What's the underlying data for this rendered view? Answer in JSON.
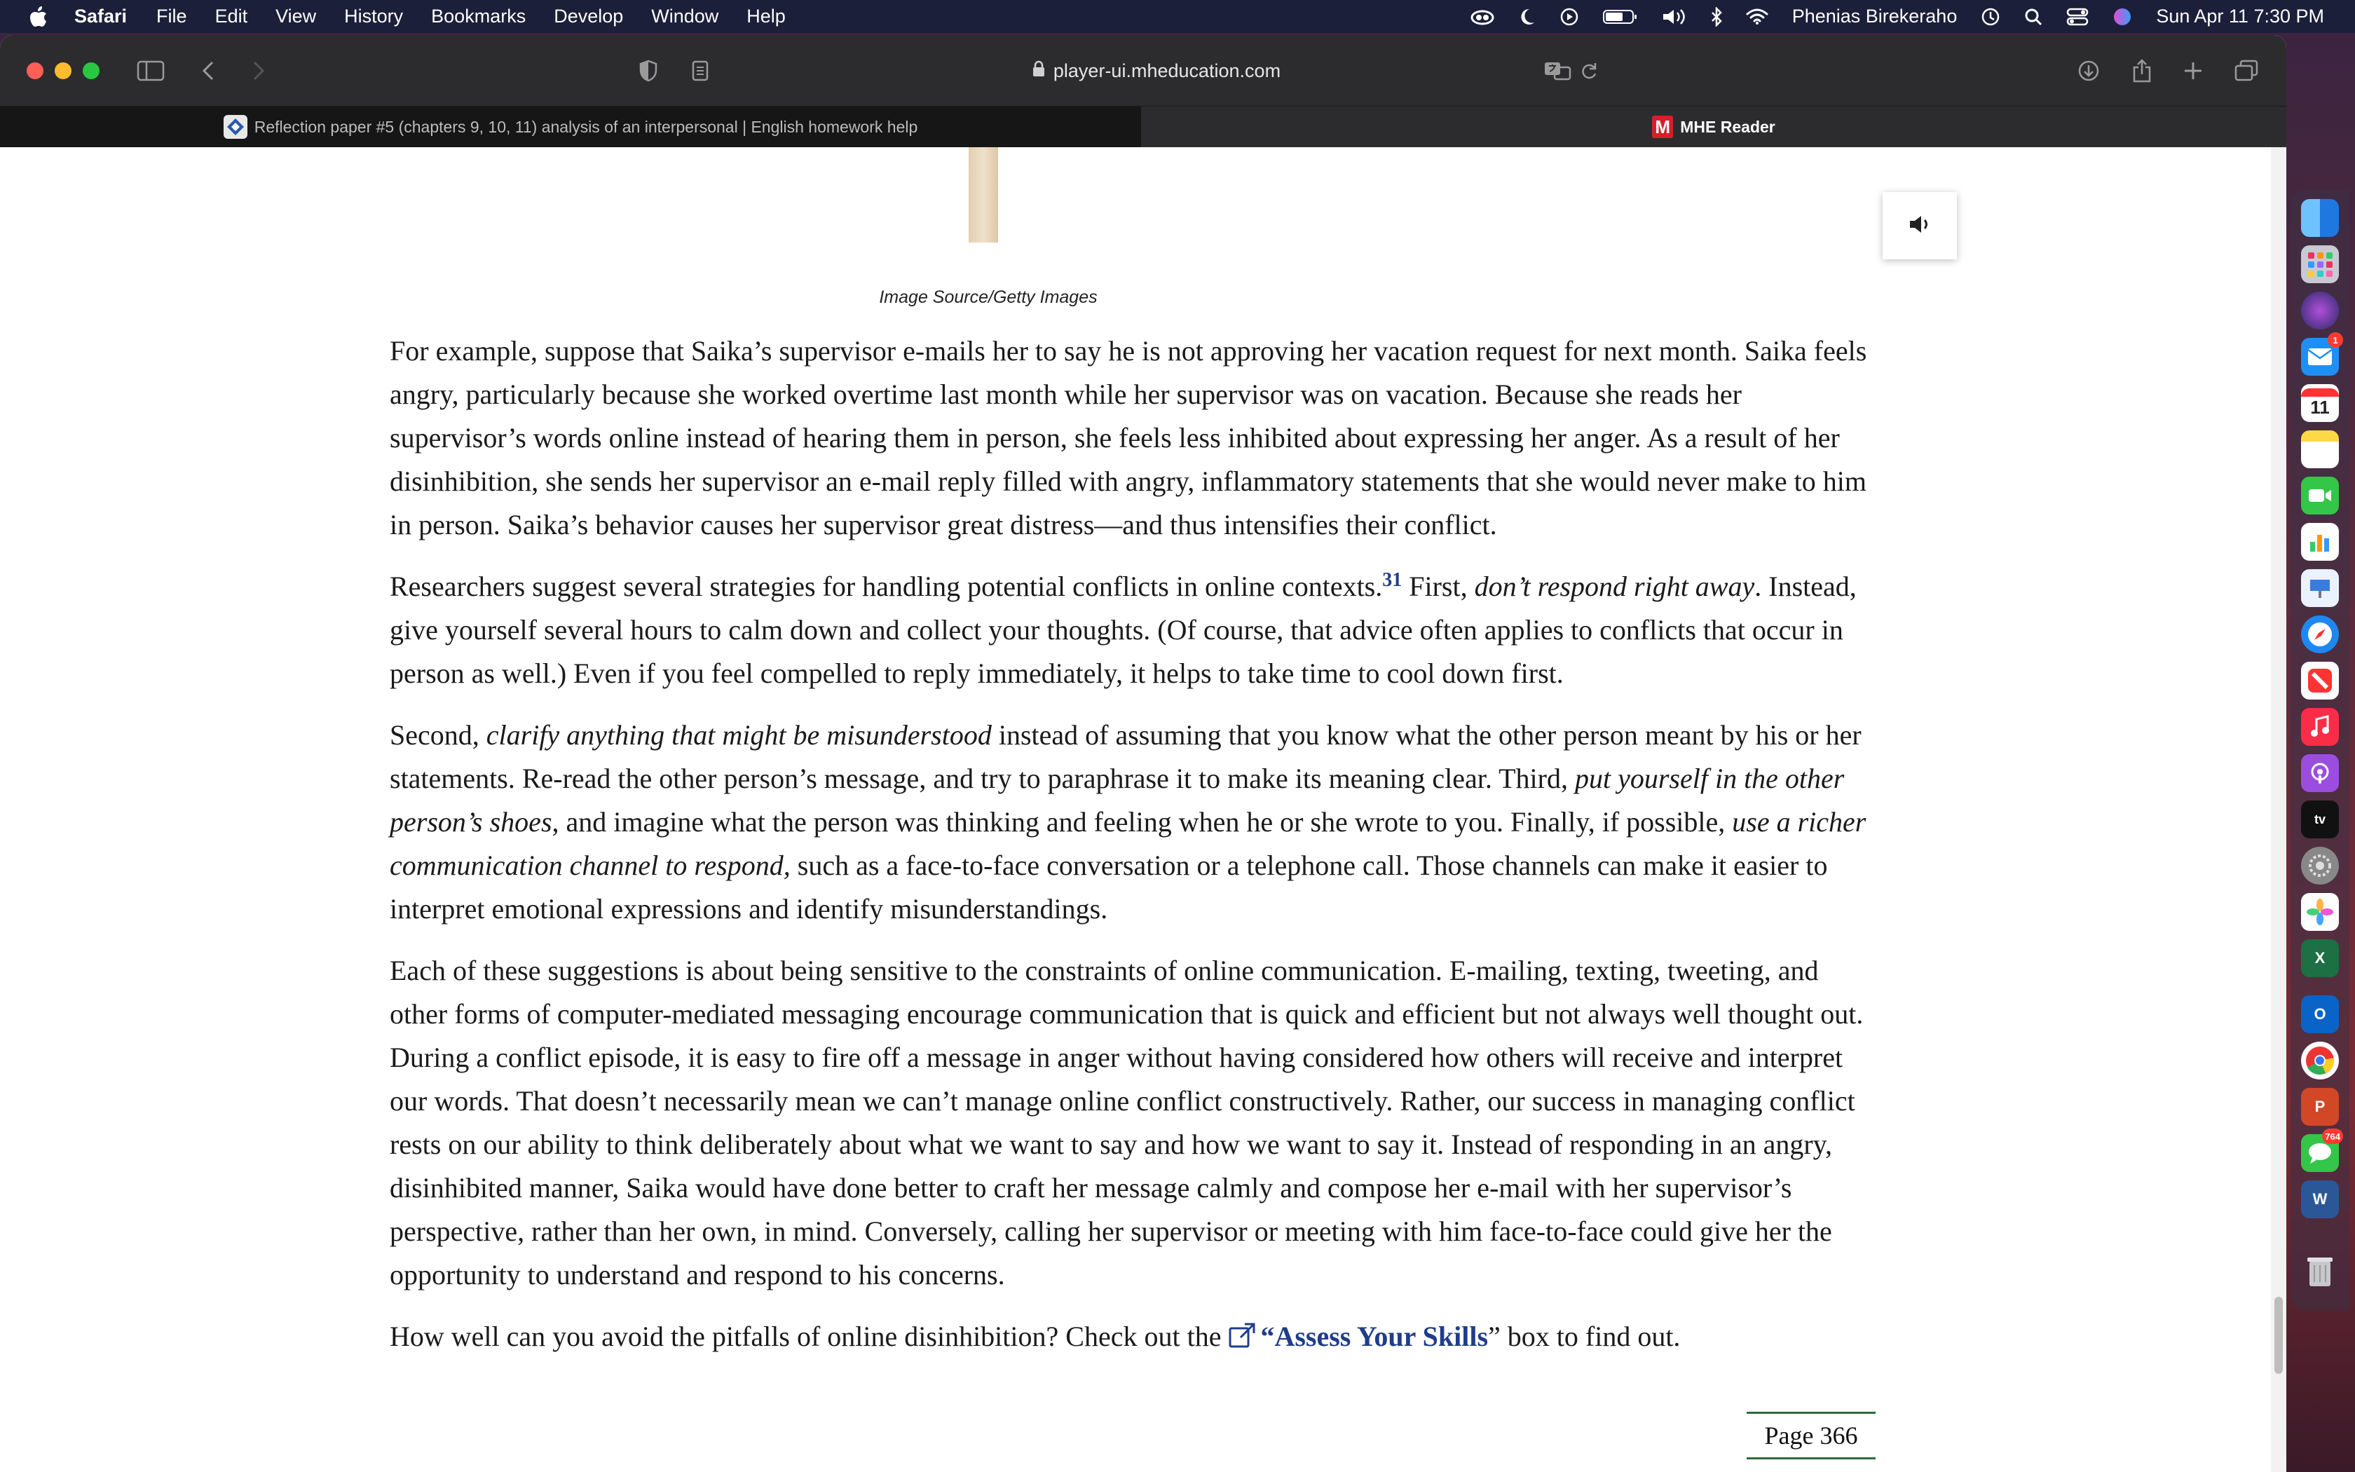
{
  "menubar": {
    "app_name": "Safari",
    "menus": [
      "File",
      "Edit",
      "View",
      "History",
      "Bookmarks",
      "Develop",
      "Window",
      "Help"
    ],
    "user_name": "Phenias Birekeraho",
    "datetime": "Sun Apr 11  7:30 PM"
  },
  "browser": {
    "url": "player-ui.mheducation.com",
    "tabs": [
      {
        "title": "Reflection paper #5 (chapters 9, 10, 11) analysis of an interpersonal | English homework help",
        "active": false
      },
      {
        "title": "MHE Reader",
        "active": true
      }
    ]
  },
  "content": {
    "image_caption": "Image Source/Getty Images",
    "paragraphs": {
      "p1": "For example, suppose that Saika’s supervisor e-mails her to say he is not approving her vacation request for next month. Saika feels angry, particularly because she worked overtime last month while her supervisor was on vacation. Because she reads her supervisor’s words online instead of hearing them in person, she feels less inhibited about expressing her anger. As a result of her disinhibition, she sends her supervisor an e-mail reply filled with angry, inflammatory statements that she would never make to him in person. Saika’s behavior causes her supervisor great distress—and thus intensifies their conflict.",
      "p2_a": "Researchers suggest several strategies for handling potential conflicts in online contexts.",
      "p2_sup": "31",
      "p2_b": " First, ",
      "p2_i1": "don’t respond right away",
      "p2_c": ". Instead, give yourself several hours to calm down and collect your thoughts. (Of course, that advice often applies to conflicts that occur in person as well.) Even if you feel compelled to reply immediately, it helps to take time to cool down first.",
      "p3_a": "Second, ",
      "p3_i1": "clarify anything that might be misunderstood",
      "p3_b": " instead of assuming that you know what the other person meant by his or her statements. Re-read the other person’s message, and try to paraphrase it to make its meaning clear. Third, ",
      "p3_i2": "put yourself in the other person’s shoes",
      "p3_c": ", and imagine what the person was thinking and feeling when he or she wrote to you. Finally, if possible, ",
      "p3_i3": "use a richer communication channel to respond,",
      "p3_d": " such as a face-to-face conversation or a telephone call. Those channels can make it easier to interpret emotional expressions and identify misunderstandings.",
      "p4": "Each of these suggestions is about being sensitive to the constraints of online communication. E-mailing, texting, tweeting, and other forms of computer-mediated messaging encourage communication that is quick and efficient but not always well thought out. During a conflict episode, it is easy to fire off a message in anger without having considered how others will receive and interpret our words. That doesn’t necessarily mean we can’t manage online conflict constructively. Rather, our success in managing conflict rests on our ability to think deliberately about what we want to say and how we want to say it. Instead of responding in an angry, disinhibited manner, Saika would have done better to craft her message calmly and compose her e-mail with her supervisor’s perspective, rather than her own, in mind. Conversely, calling her supervisor or meeting with him face-to-face could give her the opportunity to understand and respond to his concerns.",
      "p5_a": "How well can you avoid the pitfalls of online disinhibition? Check out the ",
      "p5_link": "“Assess Your Skills",
      "p5_b": "” box to find out."
    },
    "page_number": "Page 366"
  },
  "dock": {
    "calendar_day": "11",
    "mail_badge": "1",
    "messages_badge": "764"
  }
}
